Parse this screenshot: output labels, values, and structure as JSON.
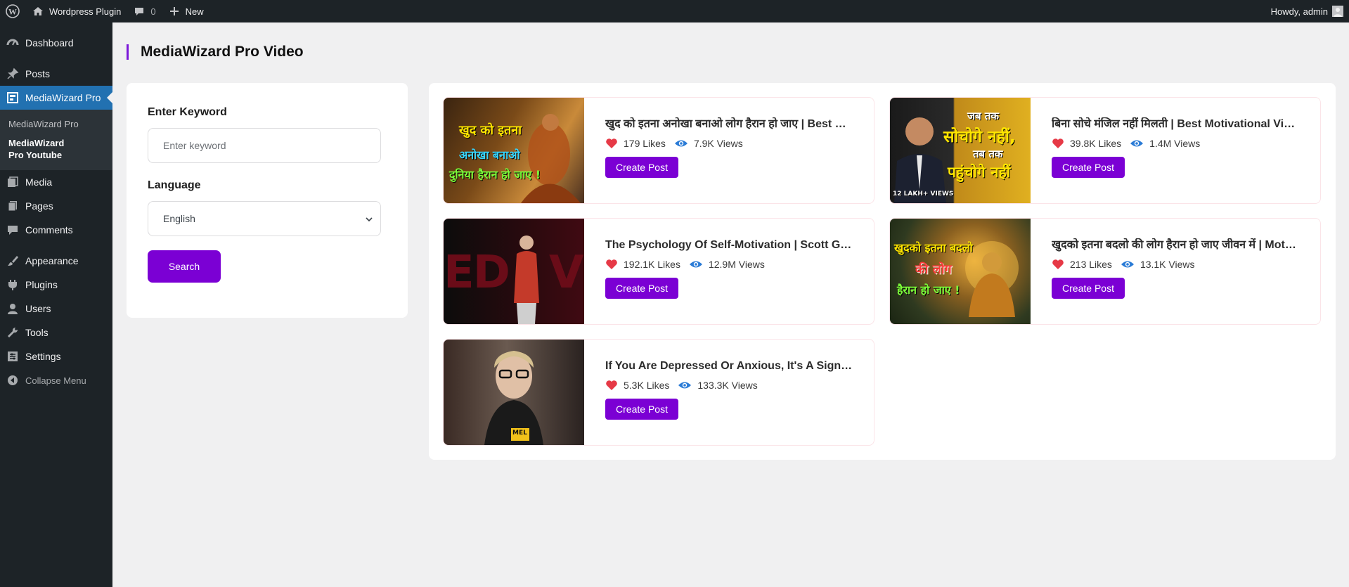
{
  "adminbar": {
    "site_name": "Wordpress Plugin",
    "comments_count": "0",
    "new_label": "New",
    "howdy": "Howdy, admin"
  },
  "sidebar": {
    "items": [
      {
        "label": "Dashboard",
        "icon": "dashboard-icon"
      },
      {
        "label": "Posts",
        "icon": "pin-icon"
      },
      {
        "label": "MediaWizard Pro",
        "icon": "media-wizard-icon"
      },
      {
        "label": "Media",
        "icon": "media-icon"
      },
      {
        "label": "Pages",
        "icon": "pages-icon"
      },
      {
        "label": "Comments",
        "icon": "comment-icon"
      },
      {
        "label": "Appearance",
        "icon": "brush-icon"
      },
      {
        "label": "Plugins",
        "icon": "plugin-icon"
      },
      {
        "label": "Users",
        "icon": "user-icon"
      },
      {
        "label": "Tools",
        "icon": "wrench-icon"
      },
      {
        "label": "Settings",
        "icon": "settings-icon"
      }
    ],
    "submenu": [
      "MediaWizard Pro",
      "MediaWizard Pro Youtube"
    ],
    "collapse_label": "Collapse Menu"
  },
  "page": {
    "title": "MediaWizard Pro Video"
  },
  "search": {
    "keyword_label": "Enter Keyword",
    "keyword_placeholder": "Enter keyword",
    "language_label": "Language",
    "language_value": "English",
    "search_button": "Search"
  },
  "results": {
    "create_label": "Create Post",
    "videos": [
      {
        "title": "खुद को इतना अनोखा बनाओ लोग हैरान हो जाए | Best Motivational Video",
        "likes": "179 Likes",
        "views": "7.9K Views",
        "thumb_lines": [
          "खुद को इतना",
          "अनोखा बनाओ",
          "दुनिया हैरान हो जाए !"
        ]
      },
      {
        "title": "बिना सोचे मंजिल नहीं मिलती | Best Motivational Video",
        "likes": "39.8K Likes",
        "views": "1.4M Views",
        "thumb_lines": [
          "जब तक",
          "सोचोगे नहीं,",
          "तब तक",
          "पहुंचोगे नहीं",
          "12 LAKH+ VIEWS"
        ]
      },
      {
        "title": "The Psychology Of Self-Motivation | Scott Geller | TEDx",
        "likes": "192.1K Likes",
        "views": "12.9M Views",
        "thumb_lines": [
          "ED",
          "Vi"
        ]
      },
      {
        "title": "खुदको इतना बदलो की लोग हैरान हो जाए जीवन में | Motivation",
        "likes": "213 Likes",
        "views": "13.1K Views",
        "thumb_lines": [
          "खुदको इतना बदलो",
          "की लोग",
          "हैरान हो जाए !"
        ]
      },
      {
        "title": "If You Are Depressed Or Anxious, It's A Sign Your Life Needs To Change",
        "likes": "5.3K Likes",
        "views": "133.3K Views",
        "thumb_lines": [
          "MEL"
        ]
      }
    ]
  },
  "colors": {
    "accent": "#7b00d4",
    "wp_dark": "#1d2327",
    "wp_blue": "#2271b1",
    "heart": "#e63946",
    "eye": "#2a7bd6"
  }
}
